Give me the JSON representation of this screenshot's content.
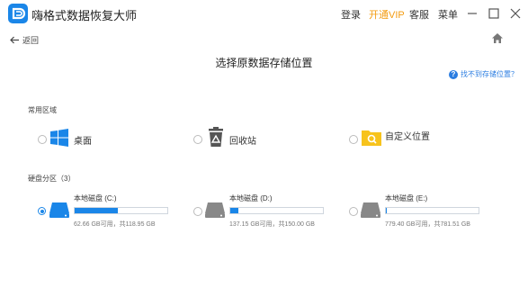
{
  "window": {
    "title": "嗨格式数据恢复大师",
    "menu": {
      "login": "登录",
      "vip": "开通VIP",
      "service": "客服",
      "menu": "菜单"
    }
  },
  "nav": {
    "back": "返回"
  },
  "page": {
    "title": "选择原数据存储位置",
    "help": "找不到存储位置？"
  },
  "common": {
    "label": "常用区域",
    "items": [
      {
        "label": "桌面",
        "icon": "windows-icon"
      },
      {
        "label": "回收站",
        "icon": "recycle-bin-icon"
      },
      {
        "label": "自定义位置",
        "icon": "folder-search-icon"
      }
    ]
  },
  "partitions": {
    "label": "硬盘分区（3）",
    "disks": [
      {
        "name": "本地磁盘 (C:)",
        "capacity": "62.66 GB可用，共118.95 GB",
        "used_fraction": 0.47,
        "selected": true
      },
      {
        "name": "本地磁盘 (D:)",
        "capacity": "137.15 GB可用，共150.00 GB",
        "used_fraction": 0.09,
        "selected": false
      },
      {
        "name": "本地磁盘 (E:)",
        "capacity": "779.40 GB可用，共781.51 GB",
        "used_fraction": 0.003,
        "selected": false
      }
    ]
  },
  "colors": {
    "accent": "#1a86e8",
    "vip": "#f39c12",
    "folder": "#f7c31d"
  }
}
